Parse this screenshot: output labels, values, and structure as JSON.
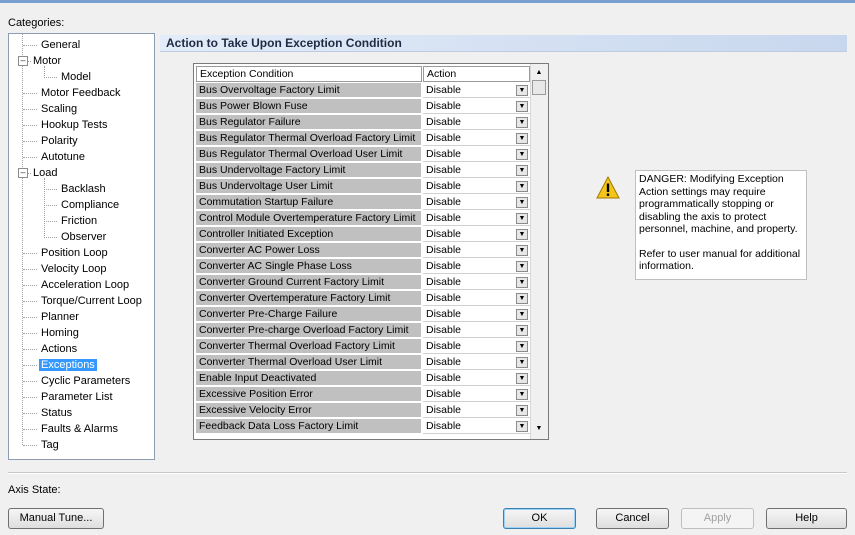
{
  "colors": {
    "selection": "#3399ff",
    "header_gradient": "#c8d7ee",
    "grid_cell": "#c0c0c0"
  },
  "categories_label": "Categories:",
  "tree": [
    {
      "label": "General",
      "depth": 1,
      "selected": false,
      "expander": null
    },
    {
      "label": "Motor",
      "depth": 0,
      "selected": false,
      "expander": "-"
    },
    {
      "label": "Model",
      "depth": 2,
      "selected": false,
      "expander": null
    },
    {
      "label": "Motor Feedback",
      "depth": 1,
      "selected": false,
      "expander": null
    },
    {
      "label": "Scaling",
      "depth": 1,
      "selected": false,
      "expander": null
    },
    {
      "label": "Hookup Tests",
      "depth": 1,
      "selected": false,
      "expander": null
    },
    {
      "label": "Polarity",
      "depth": 1,
      "selected": false,
      "expander": null
    },
    {
      "label": "Autotune",
      "depth": 1,
      "selected": false,
      "expander": null
    },
    {
      "label": "Load",
      "depth": 0,
      "selected": false,
      "expander": "-"
    },
    {
      "label": "Backlash",
      "depth": 2,
      "selected": false,
      "expander": null
    },
    {
      "label": "Compliance",
      "depth": 2,
      "selected": false,
      "expander": null
    },
    {
      "label": "Friction",
      "depth": 2,
      "selected": false,
      "expander": null
    },
    {
      "label": "Observer",
      "depth": 2,
      "selected": false,
      "expander": null
    },
    {
      "label": "Position Loop",
      "depth": 1,
      "selected": false,
      "expander": null
    },
    {
      "label": "Velocity Loop",
      "depth": 1,
      "selected": false,
      "expander": null
    },
    {
      "label": "Acceleration Loop",
      "depth": 1,
      "selected": false,
      "expander": null
    },
    {
      "label": "Torque/Current Loop",
      "depth": 1,
      "selected": false,
      "expander": null
    },
    {
      "label": "Planner",
      "depth": 1,
      "selected": false,
      "expander": null
    },
    {
      "label": "Homing",
      "depth": 1,
      "selected": false,
      "expander": null
    },
    {
      "label": "Actions",
      "depth": 1,
      "selected": false,
      "expander": null
    },
    {
      "label": "Exceptions",
      "depth": 1,
      "selected": true,
      "expander": null
    },
    {
      "label": "Cyclic Parameters",
      "depth": 1,
      "selected": false,
      "expander": null
    },
    {
      "label": "Parameter List",
      "depth": 1,
      "selected": false,
      "expander": null
    },
    {
      "label": "Status",
      "depth": 1,
      "selected": false,
      "expander": null
    },
    {
      "label": "Faults & Alarms",
      "depth": 1,
      "selected": false,
      "expander": null
    },
    {
      "label": "Tag",
      "depth": 1,
      "selected": false,
      "expander": null
    }
  ],
  "section_title": "Action to Take Upon Exception Condition",
  "grid": {
    "headers": {
      "condition": "Exception Condition",
      "action": "Action"
    },
    "rows": [
      {
        "condition": "Bus Overvoltage Factory Limit",
        "action": "Disable"
      },
      {
        "condition": "Bus Power Blown Fuse",
        "action": "Disable"
      },
      {
        "condition": "Bus Regulator Failure",
        "action": "Disable"
      },
      {
        "condition": "Bus Regulator Thermal Overload Factory Limit",
        "action": "Disable"
      },
      {
        "condition": "Bus Regulator Thermal Overload User Limit",
        "action": "Disable"
      },
      {
        "condition": "Bus Undervoltage Factory Limit",
        "action": "Disable"
      },
      {
        "condition": "Bus Undervoltage User Limit",
        "action": "Disable"
      },
      {
        "condition": "Commutation Startup Failure",
        "action": "Disable"
      },
      {
        "condition": "Control Module Overtemperature Factory Limit",
        "action": "Disable"
      },
      {
        "condition": "Controller Initiated Exception",
        "action": "Disable"
      },
      {
        "condition": "Converter AC Power Loss",
        "action": "Disable"
      },
      {
        "condition": "Converter AC Single Phase Loss",
        "action": "Disable"
      },
      {
        "condition": "Converter Ground Current Factory Limit",
        "action": "Disable"
      },
      {
        "condition": "Converter Overtemperature Factory Limit",
        "action": "Disable"
      },
      {
        "condition": "Converter Pre-Charge Failure",
        "action": "Disable"
      },
      {
        "condition": "Converter Pre-charge Overload Factory Limit",
        "action": "Disable"
      },
      {
        "condition": "Converter Thermal Overload Factory Limit",
        "action": "Disable"
      },
      {
        "condition": "Converter Thermal Overload User Limit",
        "action": "Disable"
      },
      {
        "condition": "Enable Input Deactivated",
        "action": "Disable"
      },
      {
        "condition": "Excessive Position Error",
        "action": "Disable"
      },
      {
        "condition": "Excessive Velocity Error",
        "action": "Disable"
      },
      {
        "condition": "Feedback Data Loss Factory Limit",
        "action": "Disable"
      }
    ]
  },
  "danger": {
    "icon": "warning-icon",
    "line1": "DANGER: Modifying Exception Action settings may require programmatically stopping or disabling the axis to protect personnel, machine, and property.",
    "line2": "Refer to user manual for additional information."
  },
  "axis_state_label": "Axis State:",
  "buttons": {
    "manual_tune": "Manual Tune...",
    "ok": "OK",
    "cancel": "Cancel",
    "apply": "Apply",
    "help": "Help"
  }
}
